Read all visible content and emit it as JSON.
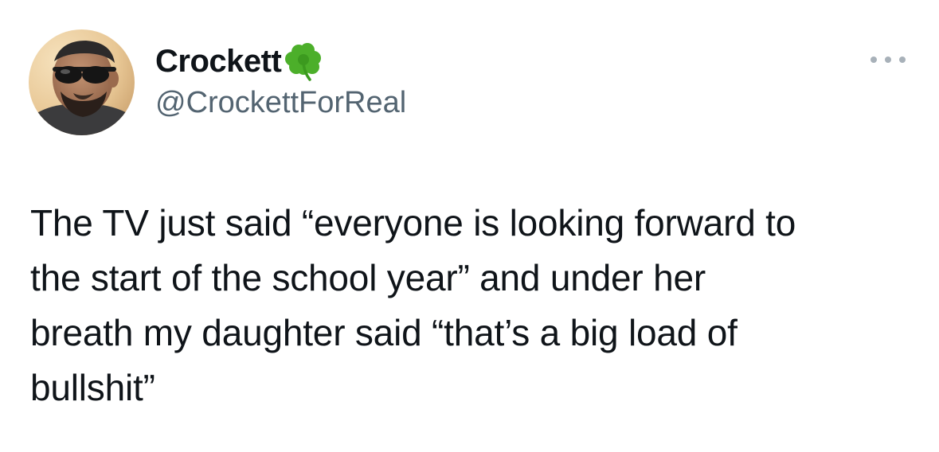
{
  "tweet": {
    "author": {
      "display_name": "Crockett",
      "badge_icon": "four-leaf-clover",
      "handle": "@CrockettForReal",
      "avatar": "profile-photo-man-with-sunglasses"
    },
    "more_icon": "more-horizontal-icon",
    "text_lines": [
      "The TV just said “everyone is looking forward to",
      "the start of the school year” and under her",
      "breath my daughter said “that’s a big load of",
      "bullshit”"
    ]
  },
  "colors": {
    "text_primary": "#0f1419",
    "text_secondary": "#536471",
    "clover_green": "#4caf2a",
    "background": "#ffffff"
  }
}
